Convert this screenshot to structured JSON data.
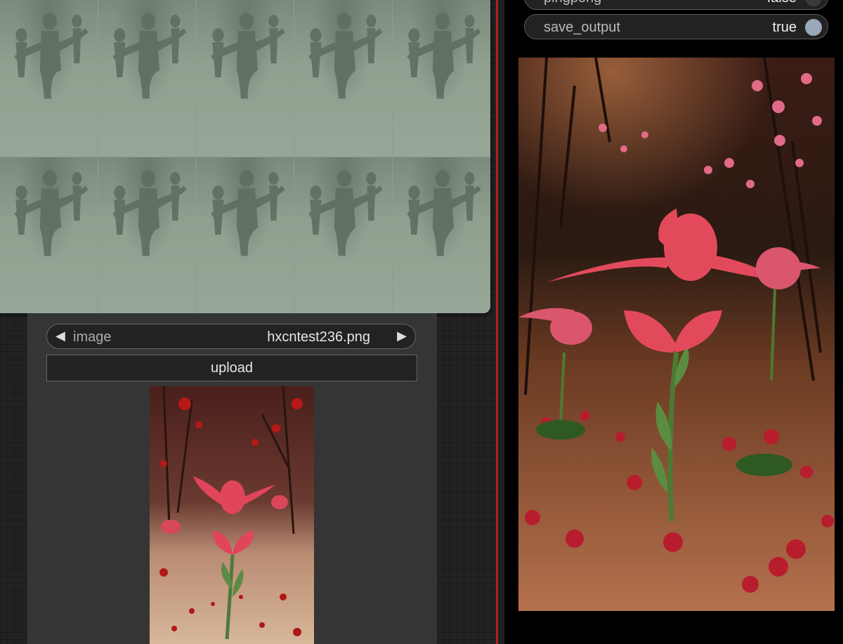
{
  "image_node": {
    "combo": {
      "arrow_left": "◀",
      "label": "image",
      "value": "hxcntest236.png",
      "arrow_right": "▶"
    },
    "upload_label": "upload"
  },
  "video_node": {
    "toggles": [
      {
        "label": "pingpong",
        "value": "false",
        "knob_color": "#3a3a3a"
      },
      {
        "label": "save_output",
        "value": "true",
        "knob_color": "#9aa9b8"
      }
    ]
  },
  "colors": {
    "divider": "#b01f1f",
    "pose_bg": "#8e9d8f",
    "rose": "#e0455a"
  }
}
